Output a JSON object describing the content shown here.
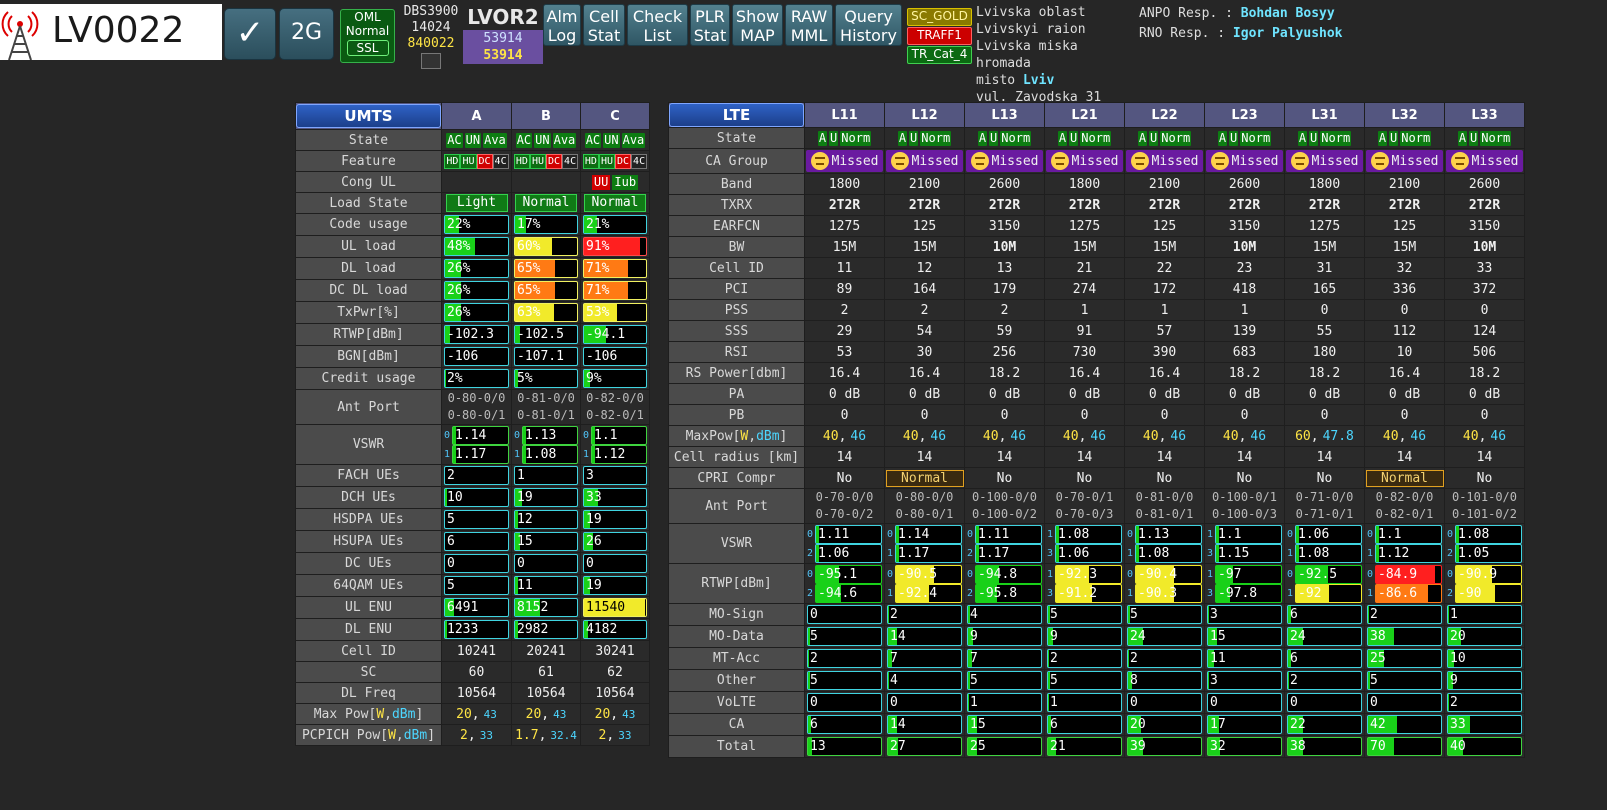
{
  "header": {
    "site_id": "LV0022",
    "check_glyph": "✓",
    "tech_2g": "2G",
    "oml": {
      "l1": "OML",
      "l2": "Normal",
      "l3": "SSL"
    },
    "node": {
      "model": "DBS3900",
      "id1": "14024",
      "id2": "840022"
    },
    "rnc": {
      "name": "LVOR2",
      "v1": "53914",
      "v2": "53914"
    },
    "toolbar": [
      {
        "l1": "Alm",
        "l2": "Log"
      },
      {
        "l1": "Cell",
        "l2": "Stat"
      },
      {
        "l1": "Check",
        "l2": "List"
      },
      {
        "l1": "PLR",
        "l2": "Stat"
      },
      {
        "l1": "Show",
        "l2": "MAP"
      },
      {
        "l1": "RAW",
        "l2": "MML"
      },
      {
        "l1": "Query",
        "l2": "History"
      }
    ],
    "tags": [
      "SC_GOLD",
      "TRAFF1",
      "TR_Cat_4"
    ],
    "address": [
      "Lvivska oblast",
      "Lvivskyi raion",
      "Lvivska miska hromada",
      "misto",
      "Lviv",
      "vul. Zavodska 31"
    ],
    "anpo_label": "ANPO Resp. :",
    "anpo_name": "Bohdan Bosyy",
    "rno_label": "RNO Resp. :",
    "rno_name": "Igor Palyushok"
  },
  "colors": {
    "green": "#19d119",
    "yellow": "#f1ea2a",
    "orange": "#ff7a14",
    "red": "#ff1f1f",
    "cyan": "#3fd4e0"
  },
  "umts": {
    "tech": "UMTS",
    "cells": [
      "A",
      "B",
      "C"
    ],
    "labels": [
      "State",
      "Feature",
      "Cong UL",
      "Load State",
      "Code usage",
      "UL load",
      "DL load",
      "DC DL load",
      "TxPwr[%]",
      "RTWP[dBm]",
      "BGN[dBm]",
      "Credit usage",
      "Ant Port",
      "VSWR",
      "FACH UEs",
      "DCH UEs",
      "HSDPA UEs",
      "HSUPA UEs",
      "DC UEs",
      "64QAM UEs",
      "UL ENU",
      "DL ENU",
      "Cell ID",
      "SC",
      "DL Freq",
      "Max Pow[",
      "PCPICH Pow["
    ],
    "pow_units": {
      "w": "W",
      "sep": ",",
      "dbm": "dBm",
      "close": "]"
    },
    "state": [
      "AC",
      "UN",
      "Ava"
    ],
    "feature": [
      "HD",
      "HU",
      "DC",
      "4C"
    ],
    "cong_ul": [
      "UU",
      "Iub"
    ],
    "load_state": [
      "Light",
      "Normal",
      "Normal"
    ],
    "bars": {
      "code": {
        "t": [
          "22%",
          "17%",
          "21%"
        ],
        "v": [
          22,
          17,
          21
        ]
      },
      "ul": {
        "t": [
          "48%",
          "60%",
          "91%"
        ],
        "v": [
          48,
          60,
          91
        ]
      },
      "dl": {
        "t": [
          "26%",
          "65%",
          "71%"
        ],
        "v": [
          26,
          65,
          71
        ]
      },
      "dcdl": {
        "t": [
          "26%",
          "65%",
          "71%"
        ],
        "v": [
          26,
          65,
          71
        ]
      },
      "txpwr": {
        "t": [
          "26%",
          "63%",
          "53%"
        ],
        "v": [
          26,
          63,
          53
        ]
      },
      "rtwp": {
        "t": [
          "-102.3",
          "-102.5",
          "-94.1"
        ],
        "v": [
          8,
          8,
          35
        ]
      },
      "bgn": {
        "t": [
          "-106",
          "-107.1",
          "-106"
        ],
        "v": [
          0,
          0,
          0
        ]
      },
      "credit": {
        "t": [
          "2%",
          "5%",
          "9%"
        ],
        "v": [
          2,
          5,
          9
        ]
      }
    },
    "antport": [
      [
        "0-80-0/0",
        "0-80-0/1"
      ],
      [
        "0-81-0/0",
        "0-81-0/1"
      ],
      [
        "0-82-0/0",
        "0-82-0/1"
      ]
    ],
    "vswr": [
      [
        [
          "0",
          "1.14"
        ],
        [
          "1",
          "1.17"
        ]
      ],
      [
        [
          "0",
          "1.13"
        ],
        [
          "1",
          "1.08"
        ]
      ],
      [
        [
          "0",
          "1.1"
        ],
        [
          "1",
          "1.12"
        ]
      ]
    ],
    "ues": {
      "fach": {
        "t": [
          "2",
          "1",
          "3"
        ],
        "v": [
          0,
          0,
          0
        ]
      },
      "dch": {
        "t": [
          "10",
          "19",
          "33"
        ],
        "v": [
          3,
          12,
          22
        ]
      },
      "hsdpa": {
        "t": [
          "5",
          "12",
          "19"
        ],
        "v": [
          0,
          5,
          10
        ]
      },
      "hsupa": {
        "t": [
          "6",
          "15",
          "26"
        ],
        "v": [
          0,
          8,
          15
        ]
      },
      "dc": {
        "t": [
          "0",
          "0",
          "0"
        ],
        "v": [
          0,
          0,
          0
        ]
      },
      "qam": {
        "t": [
          "5",
          "11",
          "19"
        ],
        "v": [
          0,
          5,
          10
        ]
      },
      "ulenu": {
        "t": [
          "6491",
          "8152",
          "11540"
        ],
        "v": [
          15,
          40,
          98
        ]
      },
      "dlenu": {
        "t": [
          "1233",
          "2982",
          "4182"
        ],
        "v": [
          3,
          5,
          6
        ]
      }
    },
    "cellid": [
      "10241",
      "20241",
      "30241"
    ],
    "sc": [
      "60",
      "61",
      "62"
    ],
    "dlfreq": [
      "10564",
      "10564",
      "10564"
    ],
    "maxpow": [
      [
        "20",
        "43"
      ],
      [
        "20",
        "43"
      ],
      [
        "20",
        "43"
      ]
    ],
    "pcpich": [
      [
        "2",
        "33"
      ],
      [
        "1.7",
        "32.4"
      ],
      [
        "2",
        "33"
      ]
    ]
  },
  "lte": {
    "tech": "LTE",
    "cells": [
      "L11",
      "L12",
      "L13",
      "L21",
      "L22",
      "L23",
      "L31",
      "L32",
      "L33"
    ],
    "labels": [
      "State",
      "CA Group",
      "Band",
      "TXRX",
      "EARFCN",
      "BW",
      "Cell ID",
      "PCI",
      "PSS",
      "SSS",
      "RSI",
      "RS Power[dbm]",
      "PA",
      "PB",
      "MaxPow[",
      "Cell radius [km]",
      "CPRI Compr",
      "Ant Port",
      "VSWR",
      "RTWP[dBm]",
      "MO-Sign",
      "MO-Data",
      "MT-Acc",
      "Other",
      "VoLTE",
      "CA",
      "Total"
    ],
    "state": [
      "A",
      "U",
      "Norm"
    ],
    "ca_group": "Missed",
    "band": [
      "1800",
      "2100",
      "2600",
      "1800",
      "2100",
      "2600",
      "1800",
      "2100",
      "2600"
    ],
    "txrx": [
      "2T2R",
      "2T2R",
      "2T2R",
      "2T2R",
      "2T2R",
      "2T2R",
      "2T2R",
      "2T2R",
      "2T2R"
    ],
    "earfcn": [
      "1275",
      "125",
      "3150",
      "1275",
      "125",
      "3150",
      "1275",
      "125",
      "3150"
    ],
    "bw": [
      "15M",
      "15M",
      "10M",
      "15M",
      "15M",
      "10M",
      "15M",
      "15M",
      "10M"
    ],
    "cellid": [
      "11",
      "12",
      "13",
      "21",
      "22",
      "23",
      "31",
      "32",
      "33"
    ],
    "pci": [
      "89",
      "164",
      "179",
      "274",
      "172",
      "418",
      "165",
      "336",
      "372"
    ],
    "pss": [
      "2",
      "2",
      "2",
      "1",
      "1",
      "1",
      "0",
      "0",
      "0"
    ],
    "sss": [
      "29",
      "54",
      "59",
      "91",
      "57",
      "139",
      "55",
      "112",
      "124"
    ],
    "rsi": [
      "53",
      "30",
      "256",
      "730",
      "390",
      "683",
      "180",
      "10",
      "506"
    ],
    "rspower": [
      "16.4",
      "16.4",
      "18.2",
      "16.4",
      "16.4",
      "18.2",
      "18.2",
      "16.4",
      "18.2"
    ],
    "pa": [
      "0 dB",
      "0 dB",
      "0 dB",
      "0 dB",
      "0 dB",
      "0 dB",
      "0 dB",
      "0 dB",
      "0 dB"
    ],
    "pb": [
      "0",
      "0",
      "0",
      "0",
      "0",
      "0",
      "0",
      "0",
      "0"
    ],
    "maxpow": [
      [
        "40",
        "46"
      ],
      [
        "40",
        "46"
      ],
      [
        "40",
        "46"
      ],
      [
        "40",
        "46"
      ],
      [
        "40",
        "46"
      ],
      [
        "40",
        "46"
      ],
      [
        "60",
        "47.8"
      ],
      [
        "40",
        "46"
      ],
      [
        "40",
        "46"
      ]
    ],
    "radius": [
      "14",
      "14",
      "14",
      "14",
      "14",
      "14",
      "14",
      "14",
      "14"
    ],
    "cpri": [
      "No",
      "Normal",
      "No",
      "No",
      "No",
      "No",
      "No",
      "Normal",
      "No"
    ],
    "antport": [
      [
        "0-70-0/0",
        "0-70-0/2"
      ],
      [
        "0-80-0/0",
        "0-80-0/1"
      ],
      [
        "0-100-0/0",
        "0-100-0/2"
      ],
      [
        "0-70-0/1",
        "0-70-0/3"
      ],
      [
        "0-81-0/0",
        "0-81-0/1"
      ],
      [
        "0-100-0/1",
        "0-100-0/3"
      ],
      [
        "0-71-0/0",
        "0-71-0/1"
      ],
      [
        "0-82-0/0",
        "0-82-0/1"
      ],
      [
        "0-101-0/0",
        "0-101-0/2"
      ]
    ],
    "vswr": [
      [
        [
          "0",
          "1.11"
        ],
        [
          "2",
          "1.06"
        ]
      ],
      [
        [
          "0",
          "1.14"
        ],
        [
          "1",
          "1.17"
        ]
      ],
      [
        [
          "0",
          "1.11"
        ],
        [
          "2",
          "1.17"
        ]
      ],
      [
        [
          "1",
          "1.08"
        ],
        [
          "3",
          "1.06"
        ]
      ],
      [
        [
          "0",
          "1.13"
        ],
        [
          "1",
          "1.08"
        ]
      ],
      [
        [
          "1",
          "1.1"
        ],
        [
          "3",
          "1.15"
        ]
      ],
      [
        [
          "0",
          "1.06"
        ],
        [
          "1",
          "1.08"
        ]
      ],
      [
        [
          "0",
          "1.1"
        ],
        [
          "1",
          "1.12"
        ]
      ],
      [
        [
          "0",
          "1.08"
        ],
        [
          "2",
          "1.05"
        ]
      ]
    ],
    "rtwp": [
      [
        [
          "0",
          "-95.1",
          35
        ],
        [
          "2",
          "-94.6",
          38
        ]
      ],
      [
        [
          "0",
          "-90.5",
          58
        ],
        [
          "1",
          "-92.4",
          50
        ]
      ],
      [
        [
          "0",
          "-94.8",
          36
        ],
        [
          "2",
          "-95.8",
          32
        ]
      ],
      [
        [
          "1",
          "-92.3",
          50
        ],
        [
          "3",
          "-91.2",
          55
        ]
      ],
      [
        [
          "0",
          "-90.4",
          58
        ],
        [
          "1",
          "-90.3",
          58
        ]
      ],
      [
        [
          "1",
          "-97",
          26
        ],
        [
          "3",
          "-97.8",
          22
        ]
      ],
      [
        [
          "0",
          "-92.5",
          49
        ],
        [
          "1",
          "-92",
          51
        ]
      ],
      [
        [
          "0",
          "-84.9",
          90
        ],
        [
          "1",
          "-86.6",
          80
        ]
      ],
      [
        [
          "0",
          "-90.9",
          56
        ],
        [
          "2",
          "-90",
          60
        ]
      ]
    ],
    "counters": {
      "mosign": {
        "t": [
          "0",
          "2",
          "4",
          "5",
          "5",
          "3",
          "6",
          "2",
          "1"
        ],
        "v": [
          0,
          2,
          3,
          3,
          3,
          2,
          4,
          2,
          1
        ]
      },
      "modata": {
        "t": [
          "5",
          "14",
          "9",
          "9",
          "24",
          "15",
          "24",
          "38",
          "20"
        ],
        "v": [
          3,
          12,
          7,
          7,
          20,
          12,
          20,
          35,
          18
        ]
      },
      "mtacc": {
        "t": [
          "2",
          "7",
          "7",
          "2",
          "2",
          "11",
          "6",
          "25",
          "10"
        ],
        "v": [
          1,
          5,
          5,
          1,
          1,
          8,
          4,
          22,
          8
        ]
      },
      "other": {
        "t": [
          "5",
          "4",
          "5",
          "5",
          "8",
          "3",
          "2",
          "5",
          "9"
        ],
        "v": [
          3,
          2,
          3,
          3,
          6,
          2,
          1,
          3,
          7
        ]
      },
      "volte": {
        "t": [
          "0",
          "0",
          "1",
          "1",
          "0",
          "0",
          "0",
          "0",
          "2"
        ],
        "v": [
          0,
          0,
          1,
          1,
          0,
          0,
          0,
          0,
          2
        ]
      },
      "ca": {
        "t": [
          "6",
          "14",
          "15",
          "6",
          "20",
          "17",
          "22",
          "42",
          "33"
        ],
        "v": [
          4,
          12,
          13,
          4,
          18,
          15,
          20,
          40,
          30
        ]
      },
      "total": {
        "t": [
          "13",
          "27",
          "25",
          "21",
          "39",
          "32",
          "38",
          "70",
          "40"
        ],
        "v": [
          6,
          14,
          13,
          11,
          20,
          16,
          20,
          36,
          20
        ]
      }
    }
  }
}
